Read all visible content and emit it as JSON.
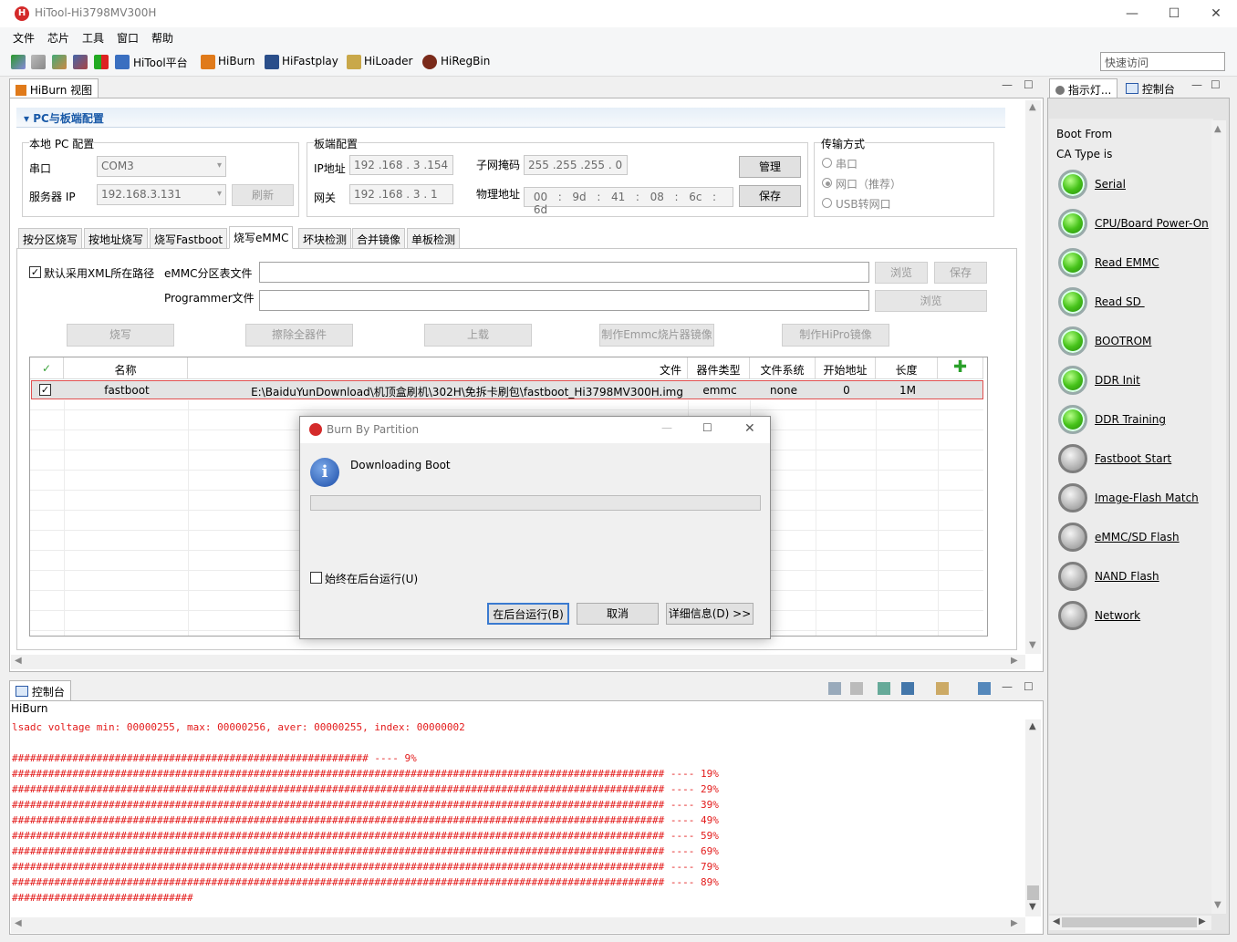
{
  "window": {
    "title": "HiTool-Hi3798MV300H",
    "min": "—",
    "max": "☐",
    "close": "✕"
  },
  "menu": [
    "文件",
    "芯片",
    "工具",
    "窗口",
    "帮助"
  ],
  "toolbar": {
    "items": [
      "HiTool平台",
      "HiBurn",
      "HiFastplay",
      "HiLoader",
      "HiRegBin"
    ],
    "quick_access": "快速访问"
  },
  "view": {
    "tab": "HiBurn 视图"
  },
  "config": {
    "section_title": "PC与板端配置",
    "local": {
      "title": "本地 PC 配置",
      "port_label": "串口",
      "port_value": "COM3",
      "ip_label": "服务器 IP",
      "ip_value": "192.168.3.131",
      "refresh": "刷新"
    },
    "board": {
      "title": "板端配置",
      "ip_label": "IP地址",
      "ip": [
        "192",
        "168",
        "3",
        "154"
      ],
      "gw_label": "网关",
      "gw": [
        "192",
        "168",
        "3",
        "1"
      ],
      "mask_label": "子网掩码",
      "mask": [
        "255",
        "255",
        "255",
        "0"
      ],
      "mac_label": "物理地址",
      "mac": [
        "00",
        "9d",
        "41",
        "08",
        "6c",
        "6d"
      ],
      "manage": "管理",
      "save": "保存"
    },
    "transport": {
      "title": "传输方式",
      "serial": "串口",
      "net": "网口（推荐）",
      "usb": "USB转网口"
    }
  },
  "tabs": [
    "按分区烧写",
    "按地址烧写",
    "烧写Fastboot",
    "烧写eMMC",
    "坏块检测",
    "合并镜像",
    "单板检测"
  ],
  "emmc": {
    "xml_check": "默认采用XML所在路径",
    "partition_label": "eMMC分区表文件",
    "programmer_label": "Programmer文件",
    "browse": "浏览",
    "save": "保存",
    "browse2": "浏览",
    "actions": [
      "烧写",
      "擦除全器件",
      "上载",
      "制作Emmc烧片器镜像",
      "制作HiPro镜像"
    ]
  },
  "table": {
    "headers": [
      "名称",
      "文件",
      "器件类型",
      "文件系统",
      "开始地址",
      "长度"
    ],
    "rows": [
      {
        "name": "fastboot",
        "file": "E:\\BaiduYunDownload\\机顶盒刷机\\302H\\免拆卡刷包\\fastboot_Hi3798MV300H.img",
        "device": "emmc",
        "fs": "none",
        "start": "0",
        "length": "1M"
      }
    ]
  },
  "dialog": {
    "title": "Burn By Partition",
    "message": "Downloading Boot",
    "progress": 0,
    "background_check": "始终在后台运行(U)",
    "run_bg": "在后台运行(B)",
    "cancel": "取消",
    "details": "详细信息(D) >>"
  },
  "console": {
    "tab": "控制台",
    "name": "HiBurn",
    "lines": [
      "lsadc voltage min: 00000255, max: 00000256, aver: 00000255, index: 00000002",
      "",
      "########################################################### ---- 9%",
      "############################################################################################################ ---- 19%",
      "############################################################################################################ ---- 29%",
      "############################################################################################################ ---- 39%",
      "############################################################################################################ ---- 49%",
      "############################################################################################################ ---- 59%",
      "############################################################################################################ ---- 69%",
      "############################################################################################################ ---- 79%",
      "############################################################################################################ ---- 89%",
      "##############################"
    ]
  },
  "right": {
    "tabs": [
      "指示灯...",
      "控制台"
    ],
    "boot_from": "Boot From",
    "ca_type": "CA Type is",
    "indicators": [
      {
        "label": "Serial",
        "state": "on"
      },
      {
        "label": "CPU/Board Power-On",
        "state": "on"
      },
      {
        "label": "Read EMMC",
        "state": "on"
      },
      {
        "label": "Read SD ",
        "state": "on"
      },
      {
        "label": "BOOTROM",
        "state": "on"
      },
      {
        "label": "DDR Init",
        "state": "on"
      },
      {
        "label": "DDR Training",
        "state": "on"
      },
      {
        "label": "Fastboot Start",
        "state": "off"
      },
      {
        "label": "Image-Flash Match",
        "state": "off"
      },
      {
        "label": "eMMC/SD Flash",
        "state": "off"
      },
      {
        "label": "NAND Flash",
        "state": "off"
      },
      {
        "label": "Network",
        "state": "off"
      }
    ]
  },
  "colors": {
    "accent": "#1a5aa8",
    "console": "#e31a1a",
    "selection_border": "#e05050"
  }
}
